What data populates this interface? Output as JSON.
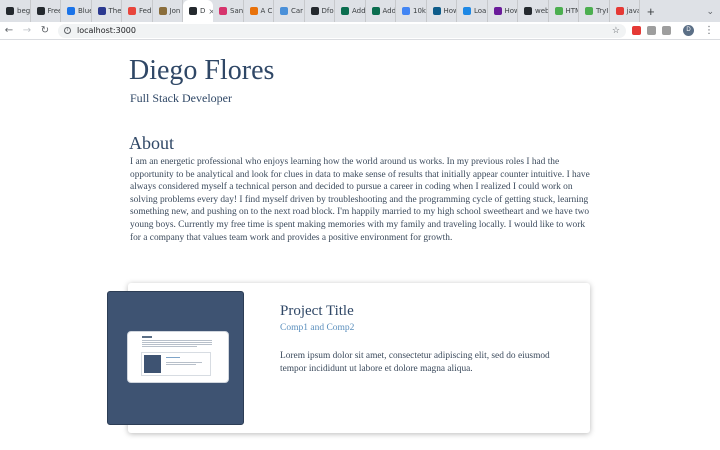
{
  "browser": {
    "tabs": [
      {
        "label": "begi",
        "color": "#24292e"
      },
      {
        "label": "Free",
        "color": "#24292e"
      },
      {
        "label": "Blue",
        "color": "#1a73e8"
      },
      {
        "label": "The",
        "color": "#2b3990"
      },
      {
        "label": "Fed",
        "color": "#e8453c"
      },
      {
        "label": "Jon",
        "color": "#8a6d3b"
      },
      {
        "label": "D",
        "color": "#24292e",
        "active": true
      },
      {
        "label": "San",
        "color": "#d6336c"
      },
      {
        "label": "A C",
        "color": "#e8710a"
      },
      {
        "label": "Car",
        "color": "#4a90d9"
      },
      {
        "label": "Dfo",
        "color": "#24292e"
      },
      {
        "label": "Add",
        "color": "#0b6e4f"
      },
      {
        "label": "Add",
        "color": "#0b6e4f"
      },
      {
        "label": "10k",
        "color": "#4285f4"
      },
      {
        "label": "How",
        "color": "#0e5c8a"
      },
      {
        "label": "Loa",
        "color": "#1e88e5"
      },
      {
        "label": "How",
        "color": "#6a1b9a"
      },
      {
        "label": "web",
        "color": "#24292e"
      },
      {
        "label": "HTM",
        "color": "#4caf50"
      },
      {
        "label": "TryI",
        "color": "#4caf50"
      },
      {
        "label": "java",
        "color": "#e53935"
      }
    ],
    "new_tab": "+",
    "close_glyph": "×",
    "url": "localhost:3000",
    "avatar_letter": "D",
    "extensions": [
      "#e53935",
      "#9e9e9e",
      "#9e9e9e"
    ]
  },
  "header": {
    "name": "Diego Flores",
    "role": "Full Stack Developer"
  },
  "about": {
    "heading": "About",
    "body": "I am an energetic professional who enjoys learning how the world around us works. In my previous roles I had the opportunity to be analytical and look for clues in data to make sense of results that initially appear counter intuitive. I have always considered myself a technical person and decided to pursue a career in coding when I realized I could work on solving problems every day! I find myself driven by troubleshooting and the programming cycle of getting stuck, learning something new, and pushing on to the next road block. I'm happily married to my high school sweetheart and we have two young boys. Currently my free time is spent making memories with my family and traveling locally. I would like to work for a company that values team work and provides a positive environment for growth."
  },
  "project": {
    "title": "Project Title",
    "components": "Comp1 and Comp2",
    "description": "Lorem ipsum dolor sit amet, consectetur adipiscing elit, sed do eiusmod tempor incididunt ut labore et dolore magna aliqua."
  }
}
